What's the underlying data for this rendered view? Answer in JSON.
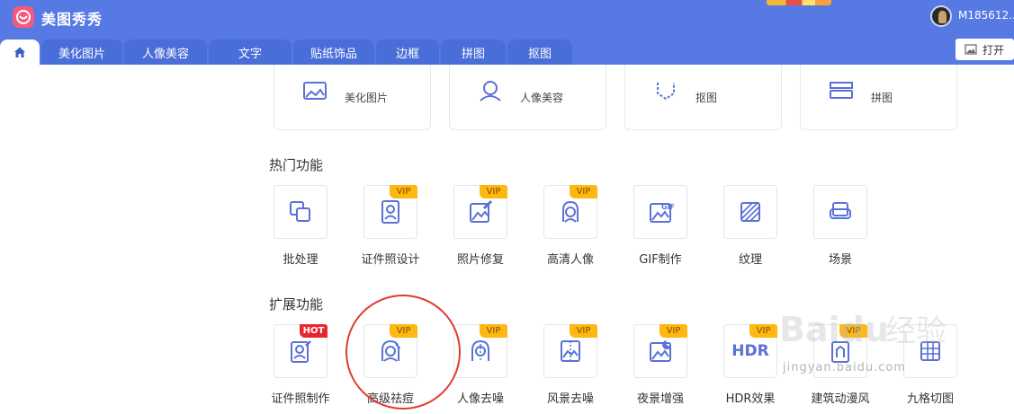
{
  "app": {
    "name": "美图秀秀",
    "username": "M185612..."
  },
  "tabs": [
    {
      "name": "tab-home",
      "label": ""
    },
    {
      "name": "tab-beautify",
      "label": "美化图片"
    },
    {
      "name": "tab-portrait",
      "label": "人像美容"
    },
    {
      "name": "tab-text",
      "label": "文字"
    },
    {
      "name": "tab-stickers",
      "label": "贴纸饰品"
    },
    {
      "name": "tab-border",
      "label": "边框"
    },
    {
      "name": "tab-puzzle",
      "label": "拼图"
    },
    {
      "name": "tab-cutout",
      "label": "抠图"
    }
  ],
  "open_button": {
    "label": "打开"
  },
  "quick_cards": [
    {
      "label": "美化图片",
      "icon": "image-icon"
    },
    {
      "label": "人像美容",
      "icon": "portrait-icon"
    },
    {
      "label": "抠图",
      "icon": "cutout-icon"
    },
    {
      "label": "拼图",
      "icon": "puzzle-icon"
    }
  ],
  "sections": {
    "hot": {
      "title": "热门功能",
      "items": [
        {
          "label": "批处理",
          "icon": "batch-icon",
          "badge": ""
        },
        {
          "label": "证件照设计",
          "icon": "id-photo-icon",
          "badge": "VIP"
        },
        {
          "label": "照片修复",
          "icon": "photo-repair-icon",
          "badge": "VIP"
        },
        {
          "label": "高清人像",
          "icon": "hd-portrait-icon",
          "badge": "VIP"
        },
        {
          "label": "GIF制作",
          "icon": "gif-icon",
          "badge": ""
        },
        {
          "label": "纹理",
          "icon": "texture-icon",
          "badge": ""
        },
        {
          "label": "场景",
          "icon": "scene-icon",
          "badge": ""
        }
      ]
    },
    "extended": {
      "title": "扩展功能",
      "items": [
        {
          "label": "证件照制作",
          "icon": "id-photo-maker-icon",
          "badge": "HOT"
        },
        {
          "label": "高级祛痘",
          "icon": "acne-removal-icon",
          "badge": "VIP"
        },
        {
          "label": "人像去噪",
          "icon": "portrait-denoise-icon",
          "badge": "VIP"
        },
        {
          "label": "风景去噪",
          "icon": "landscape-denoise-icon",
          "badge": "VIP"
        },
        {
          "label": "夜景增强",
          "icon": "night-enhance-icon",
          "badge": "VIP"
        },
        {
          "label": "HDR效果",
          "icon": "hdr-icon",
          "badge": "VIP",
          "icon_text": "HDR"
        },
        {
          "label": "建筑动漫风",
          "icon": "anime-building-icon",
          "badge": "VIP"
        },
        {
          "label": "九格切图",
          "icon": "grid-cut-icon",
          "badge": ""
        }
      ]
    }
  },
  "watermark": {
    "brand": "Baidu",
    "tag": "经验",
    "url": "jingyan.baidu.com"
  },
  "colors": {
    "primary": "#5679e4",
    "tab": "#4a6ed8",
    "icon": "#5a72d6",
    "vip": "#fdb812",
    "hot": "#e8262f",
    "highlight": "#e13a2e"
  }
}
